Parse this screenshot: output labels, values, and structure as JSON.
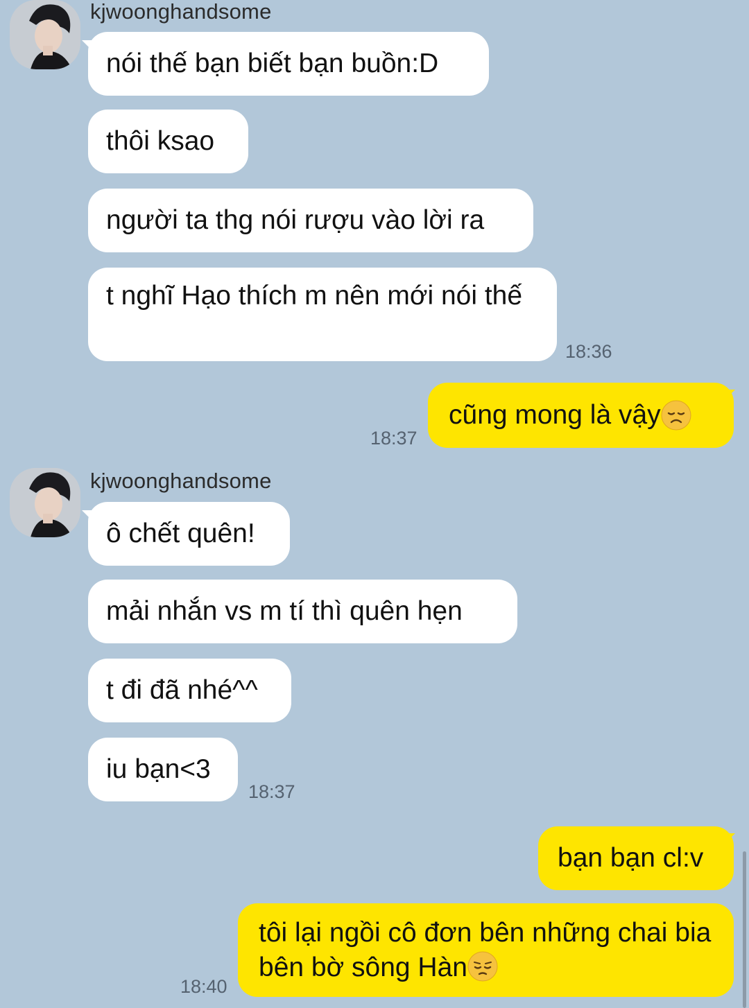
{
  "groups": [
    {
      "sender": "kjwoonghandsome",
      "avatar_icon": "profile-photo",
      "messages": [
        "nói thế bạn biết bạn buồn:D",
        "thôi ksao",
        "người ta thg nói rượu vào lời ra",
        "t nghĩ Hạo thích m nên mới nói thế"
      ],
      "time": "18:36"
    },
    {
      "sender": "kjwoonghandsome",
      "avatar_icon": "profile-photo",
      "messages": [
        "ô chết quên!",
        "mải nhắn vs m tí thì quên hẹn",
        "t đi đã nhé^^",
        "iu bạn<3"
      ],
      "time": "18:37"
    }
  ],
  "outgoing": [
    {
      "text": "cũng mong là vậy",
      "emoji": "disappointed-face",
      "time": "18:37"
    },
    {
      "text": "bạn bạn cl:v"
    },
    {
      "text": "tôi lại ngồi cô đơn bên những chai bia bên bờ sông Hàn",
      "emoji": "pensive-face",
      "time": "18:40"
    }
  ],
  "colors": {
    "background": "#b2c7d9",
    "incoming_bubble": "#ffffff",
    "outgoing_bubble": "#fee500"
  }
}
